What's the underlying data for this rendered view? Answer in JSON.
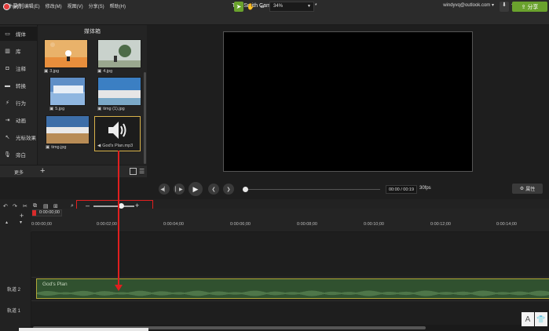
{
  "window": {
    "title": "TechSmith Camtasia - 无标题项目*",
    "user": "windyvq@outlook.com",
    "menu": [
      "文件(F)",
      "编辑(E)",
      "修改(M)",
      "视图(V)",
      "分享(S)",
      "帮助(H)"
    ]
  },
  "toolbar": {
    "record_label": "录制",
    "zoom_value": "34%",
    "share_label": "分享"
  },
  "sidebar": {
    "items": [
      {
        "label": "媒体",
        "icon": "media-icon"
      },
      {
        "label": "库",
        "icon": "library-icon"
      },
      {
        "label": "注释",
        "icon": "annotation-icon"
      },
      {
        "label": "转换",
        "icon": "transition-icon"
      },
      {
        "label": "行为",
        "icon": "behavior-icon"
      },
      {
        "label": "动画",
        "icon": "animation-icon"
      },
      {
        "label": "光标效果",
        "icon": "cursor-effect-icon"
      },
      {
        "label": "旁白",
        "icon": "microphone-icon"
      }
    ],
    "more_label": "更多"
  },
  "media_bin": {
    "title": "媒体箱",
    "items": [
      {
        "name": "3.jpg",
        "type": "image"
      },
      {
        "name": "4.jpg",
        "type": "image"
      },
      {
        "name": "5.jpg",
        "type": "image"
      },
      {
        "name": "timg (1).jpg",
        "type": "image"
      },
      {
        "name": "timg.jpg",
        "type": "image"
      },
      {
        "name": "God's Plan.mp3",
        "type": "audio"
      }
    ]
  },
  "playback": {
    "timecode": "00:00 / 00:19",
    "fps": "30fps",
    "properties_label": "属性"
  },
  "timeline": {
    "playhead_time": "0:00:00;00",
    "ticks": [
      "0:00:00;00",
      "0:00:02;00",
      "0:00:04;00",
      "0:00:06;00",
      "0:00:08;00",
      "0:00:10;00",
      "0:00:12;00",
      "0:00:14;00"
    ],
    "tracks": [
      {
        "label": "轨道 2",
        "clip": "God's Plan"
      },
      {
        "label": "轨道 1",
        "clip": ""
      }
    ]
  },
  "colors": {
    "accent": "#6aa22d",
    "highlight": "#e01f1f",
    "selection": "#d8b24a",
    "clip": "#30512f"
  }
}
